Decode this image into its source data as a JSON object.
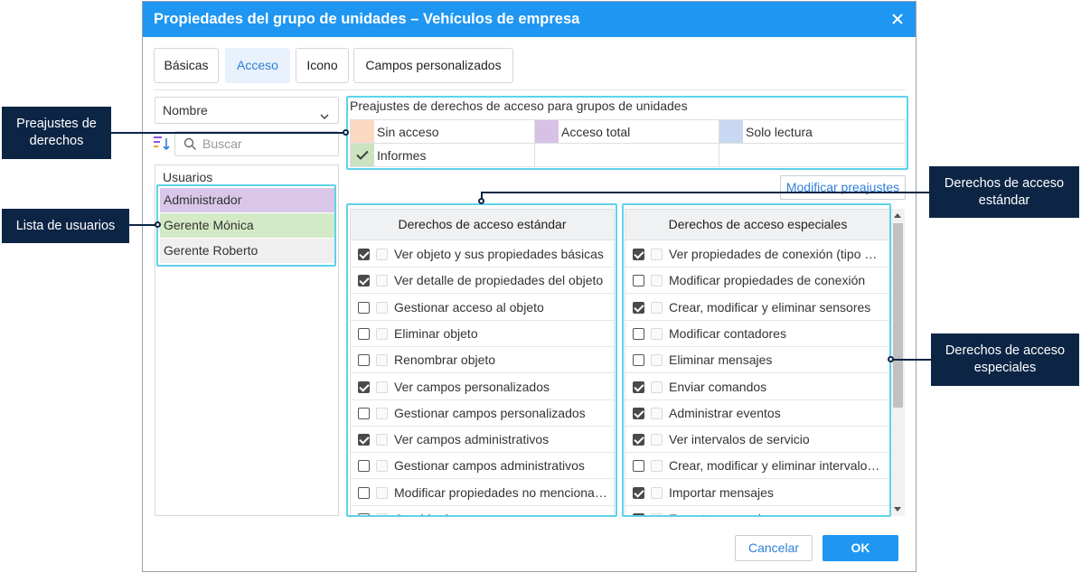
{
  "dialog": {
    "title": "Propiedades del grupo de unidades – Vehículos de empresa",
    "tabs": [
      "Básicas",
      "Acceso",
      "Icono",
      "Campos personalizados"
    ],
    "active_tab": "Acceso",
    "sort_select": "Nombre",
    "search_placeholder": "Buscar",
    "users_header": "Usuarios",
    "users": [
      {
        "name": "Administrador",
        "color": "#d9c6e8"
      },
      {
        "name": "Gerente Mónica",
        "color": "#d3eac6"
      },
      {
        "name": "Gerente Roberto",
        "color": "#efefef"
      }
    ],
    "presets_title": "Preajustes de derechos de acceso para grupos de unidades",
    "presets": [
      {
        "label": "Sin acceso",
        "color": "#fbd8c2"
      },
      {
        "label": "Acceso total",
        "color": "#d7c2e6"
      },
      {
        "label": "Solo lectura",
        "color": "#c8d8f2"
      },
      {
        "label": "Informes",
        "color": "#cbe3c0",
        "icon": "check-icon"
      }
    ],
    "modify_presets": "Modificar preajustes",
    "standard": {
      "header": "Derechos de acceso estándar",
      "rows": [
        {
          "label": "Ver objeto y sus propiedades básicas",
          "checked": true
        },
        {
          "label": "Ver detalle de propiedades del objeto",
          "checked": true
        },
        {
          "label": "Gestionar acceso al objeto",
          "checked": false
        },
        {
          "label": "Eliminar objeto",
          "checked": false
        },
        {
          "label": "Renombrar objeto",
          "checked": false
        },
        {
          "label": "Ver campos personalizados",
          "checked": true
        },
        {
          "label": "Gestionar campos personalizados",
          "checked": false
        },
        {
          "label": "Ver campos administrativos",
          "checked": true
        },
        {
          "label": "Gestionar campos administrativos",
          "checked": false
        },
        {
          "label": "Modificar propiedades no mencionadas",
          "checked": false
        },
        {
          "label": "Cambiar icono",
          "checked": false
        }
      ]
    },
    "special": {
      "header": "Derechos de acceso especiales",
      "rows": [
        {
          "label": "Ver propiedades de conexión (tipo de dispositivo)",
          "checked": true
        },
        {
          "label": "Modificar propiedades de conexión",
          "checked": false
        },
        {
          "label": "Crear, modificar y eliminar sensores",
          "checked": true
        },
        {
          "label": "Modificar contadores",
          "checked": false
        },
        {
          "label": "Eliminar mensajes",
          "checked": false
        },
        {
          "label": "Enviar comandos",
          "checked": true
        },
        {
          "label": "Administrar eventos",
          "checked": true
        },
        {
          "label": "Ver intervalos de servicio",
          "checked": true
        },
        {
          "label": "Crear, modificar y eliminar intervalos de servicio",
          "checked": false
        },
        {
          "label": "Importar mensajes",
          "checked": true
        },
        {
          "label": "Exportar mensajes",
          "checked": true
        }
      ]
    },
    "cancel": "Cancelar",
    "ok": "OK"
  },
  "callouts": {
    "presets": "Preajustes de derechos",
    "users": "Lista de usuarios",
    "standard": "Derechos de acceso estándar",
    "special": "Derechos de acceso especiales"
  },
  "colors": {
    "accent": "#1e96f2",
    "callout_bg": "#0d2545",
    "highlight": "#5fd2ea"
  }
}
